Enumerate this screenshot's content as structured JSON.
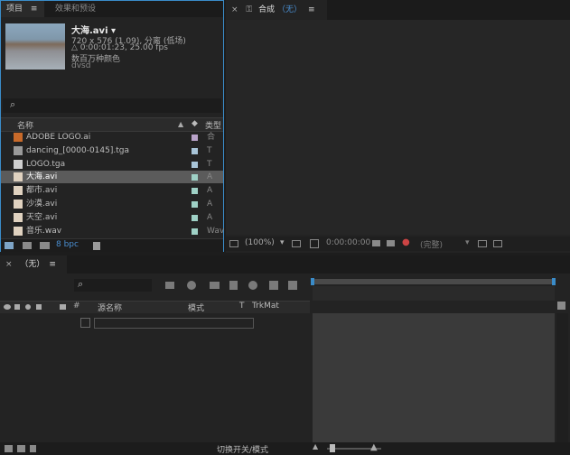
{
  "project_panel": {
    "tab_project": "项目",
    "tab_menu": "≡",
    "tab_effects": "效果和预设",
    "preview": {
      "name": "大海.avi",
      "name_arrow": "▾",
      "line1": "720 x 576 (1.09), 分离 (低场)",
      "line2": "△ 0:00:01:23, 25.00 fps",
      "line3": "数百万种颜色",
      "line4": "dvsd"
    },
    "search_icon": "⌕",
    "columns": {
      "name": "名称",
      "type": "类型"
    },
    "items": [
      {
        "name": "ADOBE LOGO.ai",
        "type": "合",
        "label_color": "#b9a3c9",
        "icon": "composition-icon"
      },
      {
        "name": "dancing_[0000-0145].tga",
        "type": "T",
        "label_color": "#a8c4d8",
        "icon": "image-sequence-icon"
      },
      {
        "name": "LOGO.tga",
        "type": "T",
        "label_color": "#a8c4d8",
        "icon": "image-file-icon"
      },
      {
        "name": "大海.avi",
        "type": "A",
        "label_color": "#9fd1c6",
        "icon": "video-file-icon"
      },
      {
        "name": "都市.avi",
        "type": "A",
        "label_color": "#9fd1c6",
        "icon": "video-file-icon"
      },
      {
        "name": "沙漠.avi",
        "type": "A",
        "label_color": "#9fd1c6",
        "icon": "video-file-icon"
      },
      {
        "name": "天空.avi",
        "type": "A",
        "label_color": "#9fd1c6",
        "icon": "video-file-icon"
      },
      {
        "name": "音乐.wav",
        "type": "Wav",
        "label_color": "#9fd1c6",
        "icon": "audio-file-icon"
      }
    ],
    "selected_index": 3,
    "bpc": "8 bpc"
  },
  "comp_panel": {
    "close": "×",
    "lock": "🔓",
    "title": "合成",
    "title_value": "（无）",
    "menu": "≡",
    "zoom": "(100%)",
    "timecode": "0:00:00:00",
    "resolution": "(完整)"
  },
  "timeline_panel": {
    "close": "×",
    "title": "（无）",
    "menu": "≡",
    "search_icon": "⌕",
    "col_source": "源名称",
    "col_mode": "模式",
    "col_t": "T",
    "col_trkmat": "TrkMat",
    "toggle_label": "切换开关/模式"
  },
  "colors": {
    "accent_blue": "#3a8cc9",
    "bpc_blue": "#4a8fd3",
    "selected_row": "#5b5b5b"
  }
}
